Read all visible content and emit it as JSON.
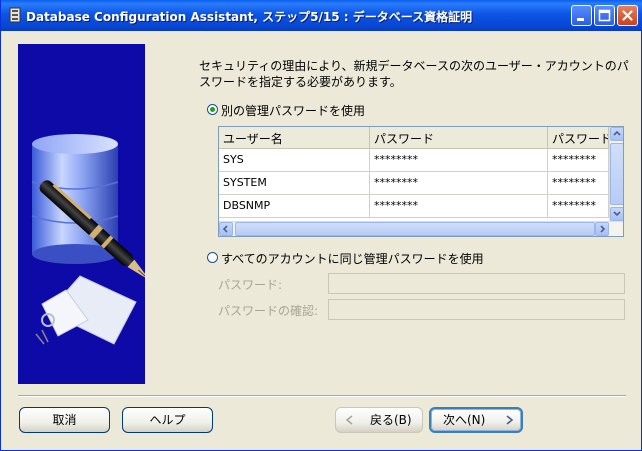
{
  "window": {
    "title": "Database Configuration Assistant, ステップ5/15 : データベース資格証明",
    "accent": "#0846d4"
  },
  "content": {
    "description": "セキュリティの理由により、新規データベースの次のユーザー・アカウントのパスワードを指定する必要があります。",
    "option_separate": {
      "label": "別の管理パスワードを使用",
      "selected": true
    },
    "option_same": {
      "label": "すべてのアカウントに同じ管理パスワードを使用",
      "selected": false
    },
    "table": {
      "columns": [
        "ユーザー名",
        "パスワード",
        "パスワードの"
      ],
      "rows": [
        [
          "SYS",
          "********",
          "********"
        ],
        [
          "SYSTEM",
          "********",
          "********"
        ],
        [
          "DBSNMP",
          "********",
          "********"
        ]
      ]
    },
    "password_label": "パスワード:",
    "confirm_label": "パスワードの確認:"
  },
  "buttons": {
    "cancel": "取消",
    "help": "ヘルプ",
    "back": "戻る(B)",
    "next": "次へ(N)"
  }
}
